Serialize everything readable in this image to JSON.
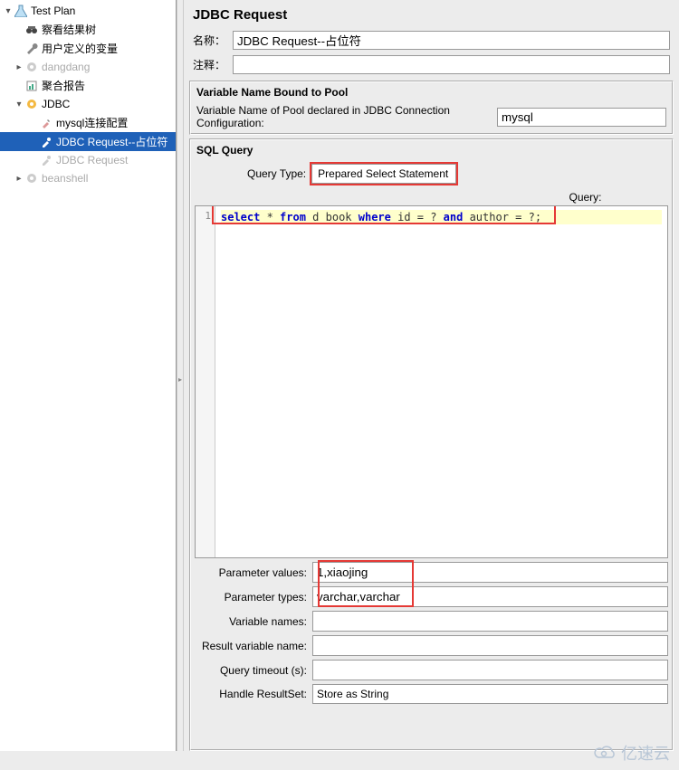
{
  "tree": {
    "root": "Test Plan",
    "items": [
      {
        "label": "察看结果树"
      },
      {
        "label": "用户定义的变量"
      },
      {
        "label": "dangdang"
      },
      {
        "label": "聚合报告"
      },
      {
        "label": "JDBC"
      },
      {
        "label": "mysql连接配置"
      },
      {
        "label": "JDBC Request--占位符"
      },
      {
        "label": "JDBC Request"
      },
      {
        "label": "beanshell"
      }
    ]
  },
  "main": {
    "title": "JDBC Request",
    "name_label": "名称：",
    "name_value": "JDBC Request--占位符",
    "comment_label": "注释：",
    "comment_value": ""
  },
  "pool": {
    "title": "Variable Name Bound to Pool",
    "label": "Variable Name of Pool declared in JDBC Connection Configuration:",
    "value": "mysql"
  },
  "sql": {
    "title": "SQL Query",
    "query_type_label": "Query Type:",
    "query_type_value": "Prepared Select Statement",
    "query_label": "Query:",
    "line_no": "1",
    "code": {
      "kw1": "select",
      "star": " * ",
      "kw2": "from",
      "tbl": " d_book ",
      "kw3": "where",
      "id": " id = ? ",
      "kw4": "and",
      "auth": " author = ?;"
    }
  },
  "fields": {
    "param_values_label": "Parameter values:",
    "param_values": "1,xiaojing",
    "param_types_label": "Parameter types:",
    "param_types": "varchar,varchar",
    "var_names_label": "Variable names:",
    "var_names": "",
    "result_var_label": "Result variable name:",
    "result_var": "",
    "timeout_label": "Query timeout (s):",
    "timeout": "",
    "handle_rs_label": "Handle ResultSet:",
    "handle_rs": "Store as String"
  },
  "logo": "亿速云"
}
